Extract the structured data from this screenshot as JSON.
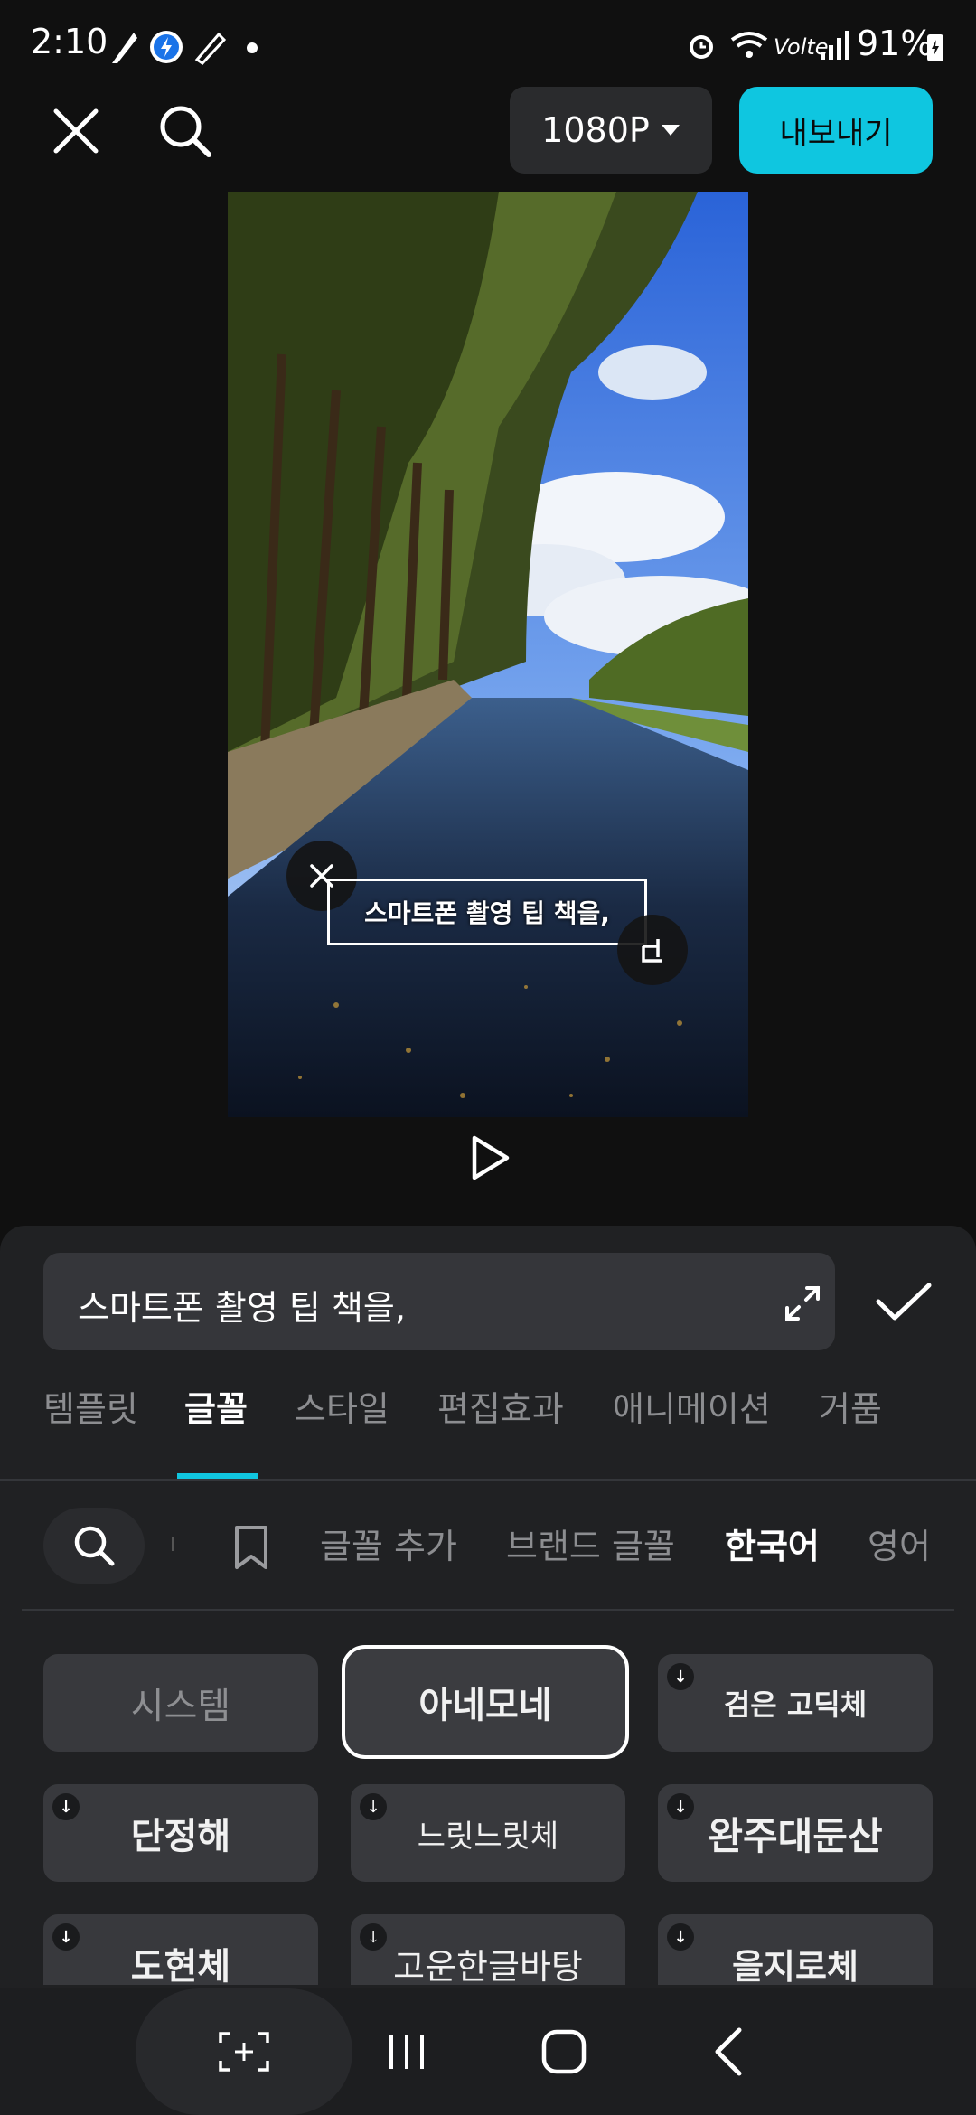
{
  "status_bar": {
    "time": "2:10",
    "network": "Volte",
    "battery": "91%"
  },
  "top_bar": {
    "resolution": "1080P",
    "export_label": "내보내기"
  },
  "caption_overlay": "스마트폰 촬영 팁 책을,",
  "text_field": {
    "value": "스마트폰 촬영 팁 책을,"
  },
  "tabs": [
    {
      "label": "템플릿"
    },
    {
      "label": "글꼴",
      "active": true
    },
    {
      "label": "스타일"
    },
    {
      "label": "편집효과"
    },
    {
      "label": "애니메이션"
    },
    {
      "label": "거품"
    }
  ],
  "filters": {
    "add_font": "글꼴 추가",
    "brand_font": "브랜드 글꼴",
    "korean": "한국어",
    "english": "영어"
  },
  "fonts": [
    {
      "label": "시스템",
      "selected": false,
      "download": false
    },
    {
      "label": "아네모네",
      "selected": true,
      "download": false
    },
    {
      "label": "검은 고딕체",
      "selected": false,
      "download": true
    },
    {
      "label": "단정해",
      "selected": false,
      "download": true
    },
    {
      "label": "느릿느릿체",
      "selected": false,
      "download": true
    },
    {
      "label": "완주대둔산",
      "selected": false,
      "download": true
    },
    {
      "label": "도현체",
      "selected": false,
      "download": true
    },
    {
      "label": "고운한글바탕",
      "selected": false,
      "download": true
    },
    {
      "label": "을지로체",
      "selected": false,
      "download": true
    }
  ],
  "colors": {
    "accent": "#10c6df",
    "panel": "#202123",
    "card": "#38393d"
  }
}
